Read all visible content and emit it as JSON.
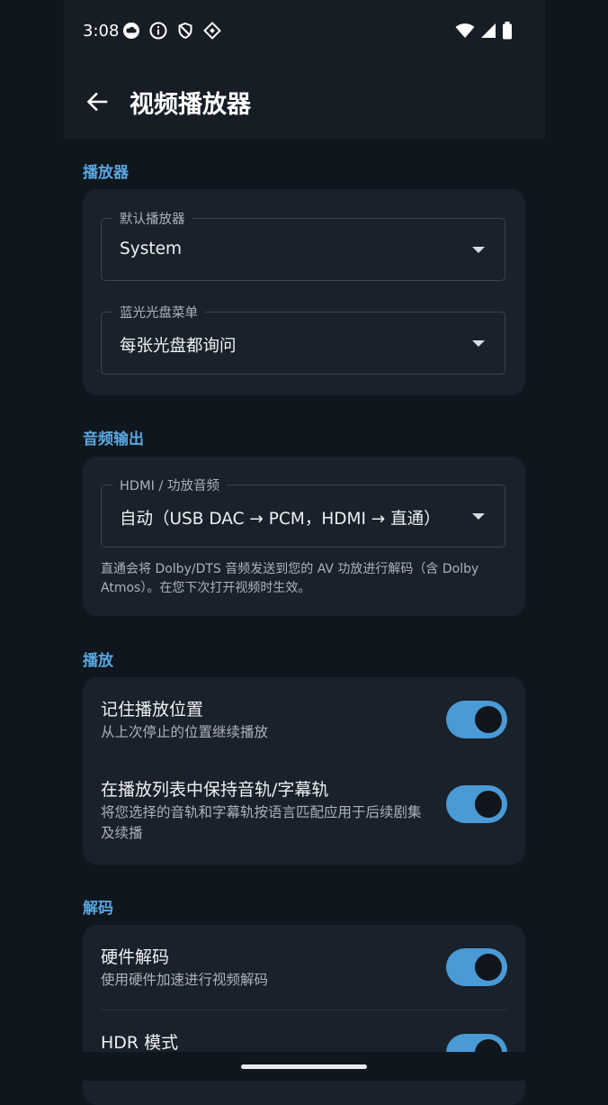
{
  "status_bar": {
    "time": "3:08",
    "left_icons": [
      "cloud-icon",
      "info-icon",
      "shield-icon",
      "vpn-key-icon"
    ],
    "right_icons": [
      "wifi-icon",
      "signal-icon",
      "battery-icon"
    ]
  },
  "app_bar": {
    "title": "视频播放器",
    "back_icon": "back-arrow-icon"
  },
  "sections": {
    "player": {
      "header": "播放器",
      "default_player": {
        "label": "默认播放器",
        "value": "System"
      },
      "bluray_menu": {
        "label": "蓝光光盘菜单",
        "value": "每张光盘都询问"
      }
    },
    "audio_output": {
      "header": "音频输出",
      "hdmi": {
        "label": "HDMI / 功放音频",
        "value": "自动（USB DAC → PCM，HDMI → 直通）"
      },
      "helper": "直通会将 Dolby/DTS 音频发送到您的 AV 功放进行解码（含 Dolby Atmos）。在您下次打开视频时生效。"
    },
    "playback": {
      "header": "播放",
      "remember_position": {
        "title": "记住播放位置",
        "subtitle": "从上次停止的位置继续播放",
        "enabled": true
      },
      "keep_tracks": {
        "title": "在播放列表中保持音轨/字幕轨",
        "subtitle": "将您选择的音轨和字幕轨按语言匹配应用于后续剧集及续播",
        "enabled": true
      }
    },
    "decoding": {
      "header": "解码",
      "hardware_decoding": {
        "title": "硬件解码",
        "subtitle": "使用硬件加速进行视频解码",
        "enabled": true
      },
      "hdr_mode": {
        "title": "HDR 模式",
        "enabled": true
      }
    }
  },
  "colors": {
    "accent": "#5aa7e0",
    "toggle_on": "#4a9ad6",
    "background": "#0f161e",
    "card": "#19212b"
  }
}
